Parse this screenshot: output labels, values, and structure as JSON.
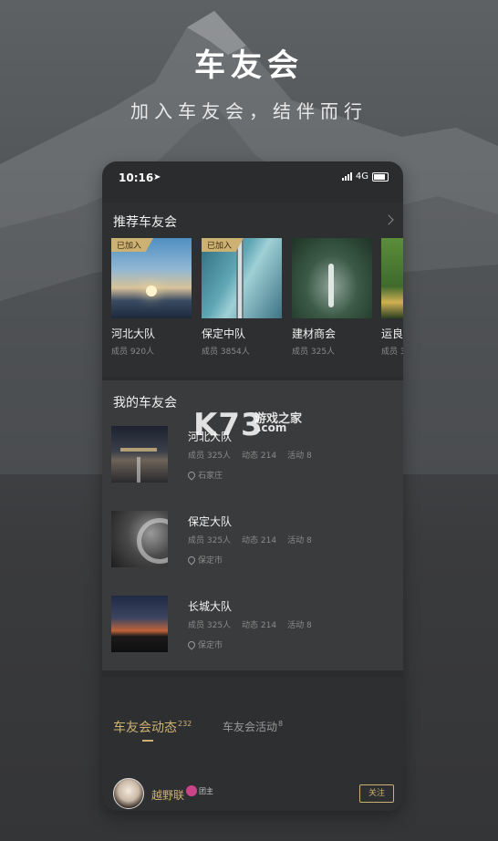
{
  "hero": {
    "title": "车友会",
    "subtitle": "加入车友会，结伴而行"
  },
  "status_bar": {
    "time": "10:16",
    "network": "4G"
  },
  "recommended": {
    "title": "推荐车友会",
    "items": [
      {
        "name": "河北大队",
        "meta": "成员 920人",
        "badge": "已加入"
      },
      {
        "name": "保定中队",
        "meta": "成员 3854人",
        "badge": "已加入"
      },
      {
        "name": "建材商会",
        "meta": "成员 325人"
      },
      {
        "name": "运良",
        "meta": "成员 3"
      }
    ]
  },
  "my_clubs": {
    "title": "我的车友会",
    "items": [
      {
        "name": "河北大队",
        "members": "成员 325人",
        "posts": "动态 214",
        "events": "活动 8",
        "location": "石家庄"
      },
      {
        "name": "保定大队",
        "members": "成员 325人",
        "posts": "动态 214",
        "events": "活动 8",
        "location": "保定市"
      },
      {
        "name": "长城大队",
        "members": "成员 325人",
        "posts": "动态 214",
        "events": "活动 8",
        "location": "保定市"
      }
    ]
  },
  "tabs": [
    {
      "label": "车友会动态",
      "count": "232"
    },
    {
      "label": "车友会活动",
      "count": "8"
    }
  ],
  "feed": {
    "username": "越野联",
    "user_badge": "团主",
    "follow_label": "关注"
  },
  "watermark": {
    "logo": "K73",
    "text": "游戏之家",
    "domain": ".com"
  },
  "colors": {
    "accent": "#cdb173",
    "background": "#2b2c2d"
  }
}
